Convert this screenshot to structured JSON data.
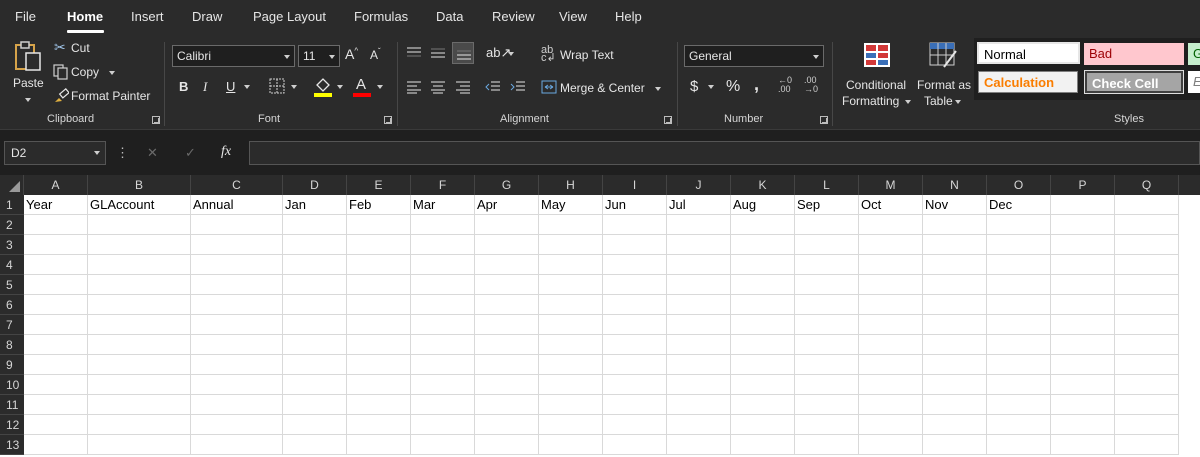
{
  "menu": {
    "tabs": [
      {
        "label": "File",
        "active": false
      },
      {
        "label": "Home",
        "active": true
      },
      {
        "label": "Insert",
        "active": false
      },
      {
        "label": "Draw",
        "active": false
      },
      {
        "label": "Page Layout",
        "active": false
      },
      {
        "label": "Formulas",
        "active": false
      },
      {
        "label": "Data",
        "active": false
      },
      {
        "label": "Review",
        "active": false
      },
      {
        "label": "View",
        "active": false
      },
      {
        "label": "Help",
        "active": false
      }
    ]
  },
  "ribbon": {
    "clipboard": {
      "paste_label": "Paste",
      "cut_label": "Cut",
      "copy_label": "Copy",
      "format_painter_label": "Format Painter",
      "group_label": "Clipboard"
    },
    "font": {
      "font_name": "Calibri",
      "font_size": "11",
      "bold": "B",
      "italic": "I",
      "underline": "U",
      "group_label": "Font",
      "highlight_color": "#ffff00",
      "font_color": "#ff0000"
    },
    "alignment": {
      "wrap_text_label": "Wrap Text",
      "merge_center_label": "Merge & Center",
      "group_label": "Alignment"
    },
    "number": {
      "format": "General",
      "currency": "$",
      "percent": "%",
      "comma": ",",
      "group_label": "Number"
    },
    "styles": {
      "conditional_formatting_line1": "Conditional",
      "conditional_formatting_line2": "Formatting",
      "format_as_table_line1": "Format as",
      "format_as_table_line2": "Table",
      "group_label": "Styles",
      "cell_styles": [
        {
          "label": "Normal",
          "bg": "#ffffff",
          "fg": "#000000"
        },
        {
          "label": "Bad",
          "bg": "#ffc7ce",
          "fg": "#9c0006"
        },
        {
          "label": "G",
          "bg": "#c6efce",
          "fg": "#006100"
        },
        {
          "label": "Calculation",
          "bg": "#f2f2f2",
          "fg": "#fa7d00"
        },
        {
          "label": "Check Cell",
          "bg": "#a5a5a5",
          "fg": "#ffffff"
        },
        {
          "label": "E",
          "bg": "#ffffff",
          "fg": "#7f7f7f"
        }
      ]
    }
  },
  "formula_bar": {
    "name_box": "D2",
    "more_symbol": "⋮",
    "cancel_symbol": "✕",
    "enter_symbol": "✓",
    "fx_symbol": "fx",
    "formula": ""
  },
  "sheet": {
    "columns": [
      "A",
      "B",
      "C",
      "D",
      "E",
      "F",
      "G",
      "H",
      "I",
      "J",
      "K",
      "L",
      "M",
      "N",
      "O",
      "P",
      "Q"
    ],
    "rows": [
      "1",
      "2",
      "3",
      "4",
      "5",
      "6",
      "7",
      "8",
      "9",
      "10",
      "11",
      "12",
      "13"
    ],
    "row1_values": [
      "Year",
      "GLAccount",
      "Annual",
      "Jan",
      "Feb",
      "Mar",
      "Apr",
      "May",
      "Jun",
      "Jul",
      "Aug",
      "Sep",
      "Oct",
      "Nov",
      "Dec",
      "",
      ""
    ]
  }
}
